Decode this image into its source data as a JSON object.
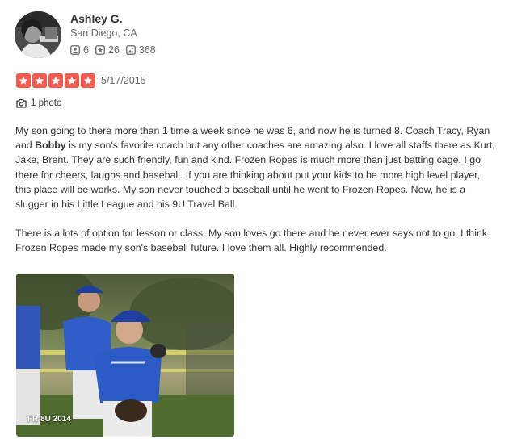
{
  "user": {
    "name": "Ashley G.",
    "location": "San Diego, CA",
    "stats": {
      "friends": "6",
      "reviews": "26",
      "photos": "368"
    }
  },
  "review": {
    "rating": 5,
    "date": "5/17/2015",
    "photo_count_label": "1 photo",
    "para1_part1": "My son going to there more than 1 time a week since he was 6, and now he is turned 8. Coach Tracy, Ryan and ",
    "para1_bold": "Bobby",
    "para1_part2": " is my son's favorite coach but any other coaches are amazing also. I love all staffs there as Kurt, Jake, Brent. They are such friendly, fun and kind. Frozen Ropes is much more than just batting cage. I go there for cheers, laughs and baseball. If you are thinking about put your kids to be more high level player, this place will be works. My son never touched a baseball until he went to Frozen Ropes. Now, he is a slugger in his Little League and his 9U Travel Ball.",
    "para2": "There is a lots of option for lesson or class. My son loves go there and he never ever says not to go. I think Frozen Ropes made my son's baseball future. I love them all. Highly recommended.",
    "photo_caption": "FR 8U 2014"
  },
  "colors": {
    "star_red": "#f15c4f",
    "text": "#333333",
    "muted": "#666666"
  },
  "icons": {
    "friends": "friends-icon",
    "reviews": "review-star-icon",
    "photos": "photo-icon",
    "camera": "camera-icon",
    "star": "star-icon"
  }
}
